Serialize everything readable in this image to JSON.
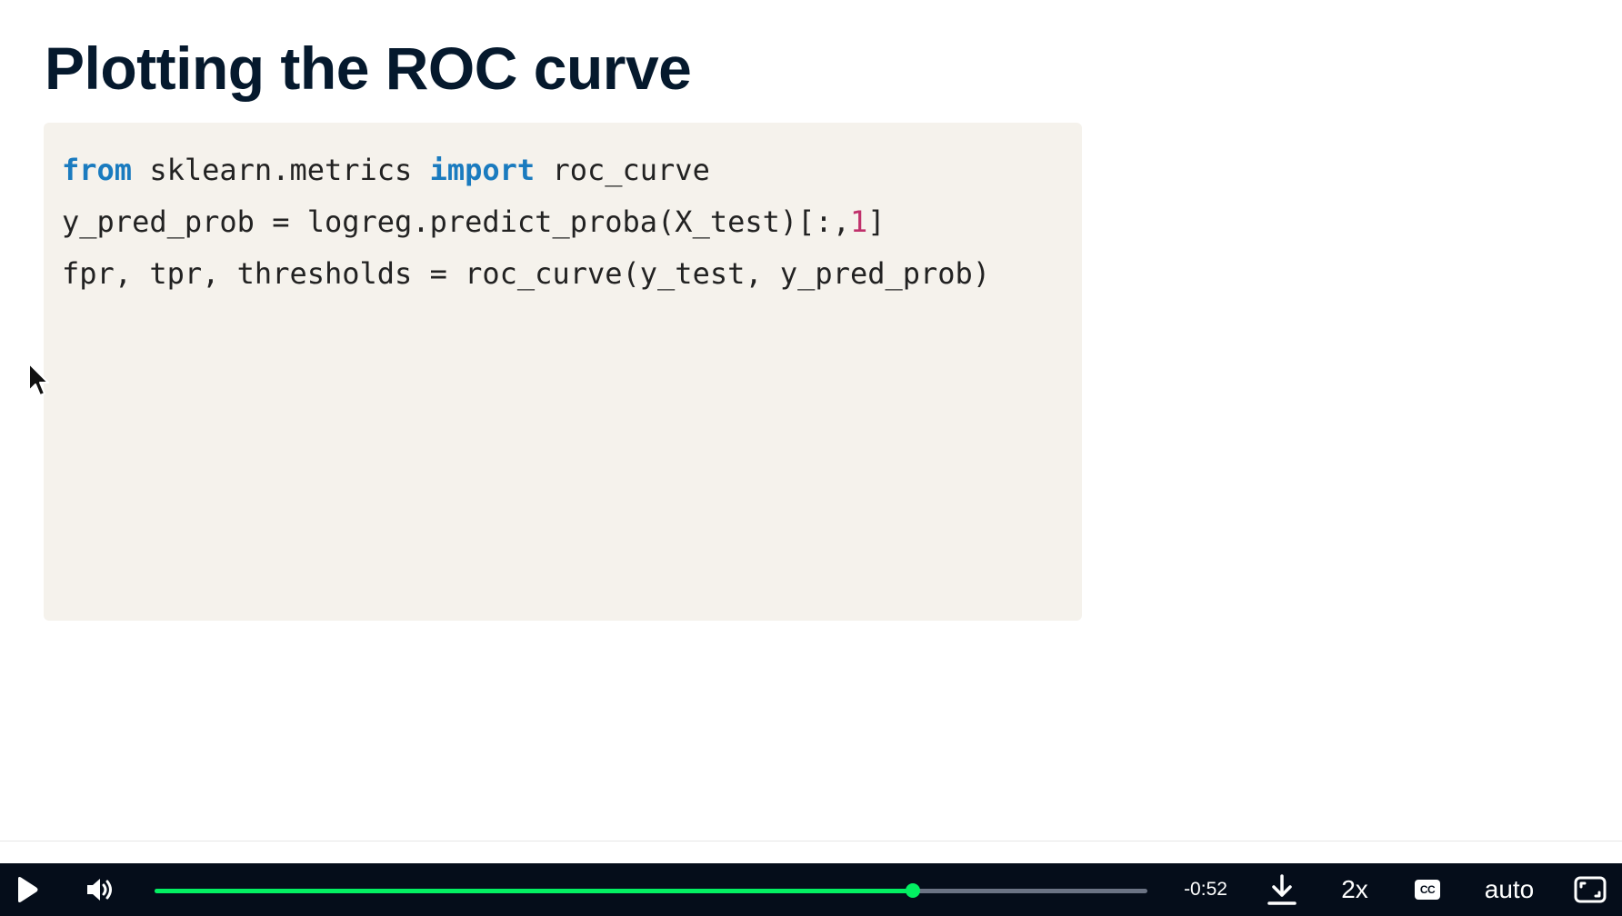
{
  "slide": {
    "title": "Plotting the ROC curve",
    "code_lines": [
      [
        {
          "t": "from",
          "k": "kw"
        },
        {
          "t": " sklearn.metrics ",
          "k": ""
        },
        {
          "t": "import",
          "k": "kw"
        },
        {
          "t": " roc_curve",
          "k": ""
        }
      ],
      [
        {
          "t": "y_pred_prob = logreg.predict_proba(X_test)[:,",
          "k": ""
        },
        {
          "t": "1",
          "k": "num"
        },
        {
          "t": "]",
          "k": ""
        }
      ],
      [
        {
          "t": "fpr, tpr, thresholds = roc_curve(y_test, y_pred_prob)",
          "k": ""
        }
      ]
    ],
    "colors": {
      "title": "#05192d",
      "keyword": "#1a7bbf",
      "number": "#c0306b",
      "code_background": "#f5f2ec"
    }
  },
  "player": {
    "play_icon": "play-icon",
    "volume_icon": "volume-icon",
    "progress_percent": 76.4,
    "time_remaining": "-0:52",
    "download_icon": "download-icon",
    "speed_label": "2x",
    "captions_label": "CC",
    "quality_label": "auto",
    "fullscreen_icon": "fullscreen-icon",
    "colors": {
      "bar_background": "#050d1a",
      "progress": "#03ef62",
      "track": "#6b7384"
    }
  }
}
